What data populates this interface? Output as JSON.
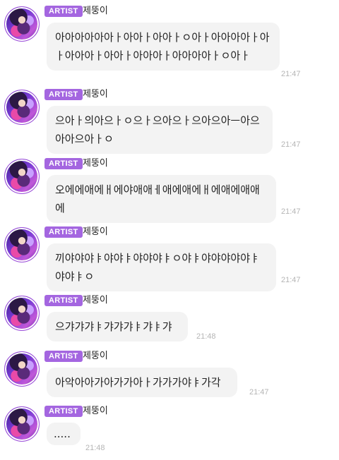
{
  "artist_badge": "ARTIST",
  "sender_name": "제뚱이",
  "messages": [
    {
      "text": "아아아아아아ㅏ아아ㅏ아아ㅏㅇ아ㅏ아아아아ㅏ아ㅏ아아아ㅏ아아ㅏ아아아ㅏ아아아아ㅏㅇ아ㅏ",
      "time": "21:47"
    },
    {
      "text": "으아ㅏ의아으ㅏㅇ으ㅏ으아으ㅏ으아으아ㅡ아으아아으아ㅏㅇ",
      "time": "21:47"
    },
    {
      "text": "오에에애에ㅐ에야애애ㅔ애에애에ㅐ에애에애애에",
      "time": "21:47"
    },
    {
      "text": "끼야야야ㅑ야야ㅑ야야야ㅑㅇ야ㅑ야야야야야ㅑ야야ㅑㅇ",
      "time": "21:47"
    },
    {
      "text": "으갸갸갸ㅑ갸갸갸ㅑ갸ㅑ갸",
      "time": "21:48"
    },
    {
      "text": "아악아아가아가가아ㅏ가가가야ㅑ가각",
      "time": "21:47"
    },
    {
      "text": ".....",
      "time": "21:48"
    }
  ]
}
